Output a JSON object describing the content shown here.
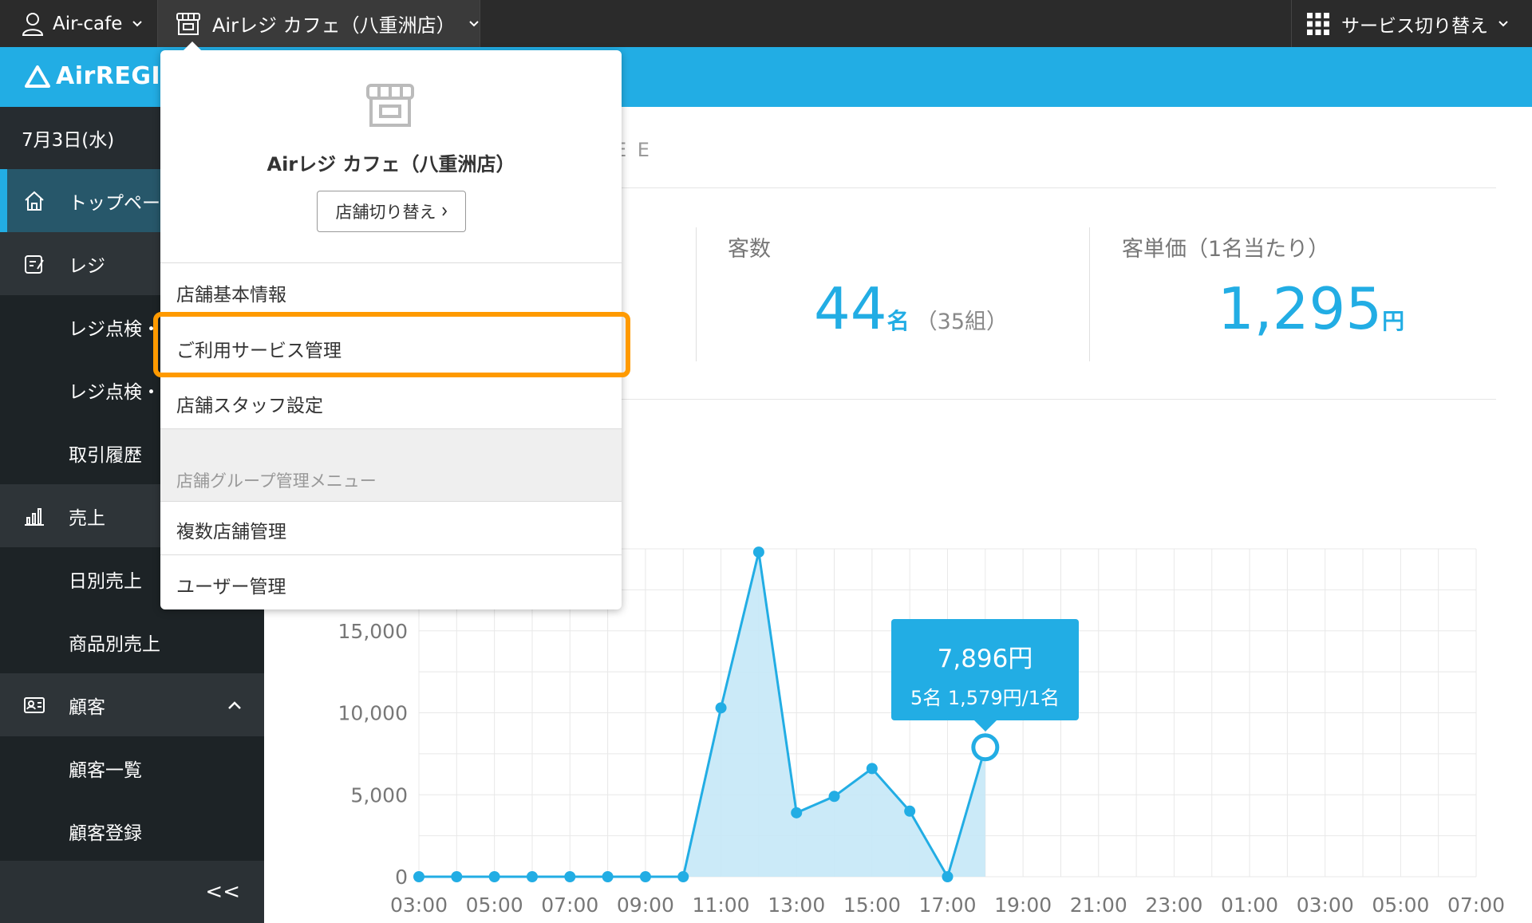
{
  "topbar": {
    "account_name": "Air-cafe",
    "store_name": "Airレジ カフェ（八重洲店）",
    "service_switch": "サービス切り替え"
  },
  "logo": {
    "text": "AirREGI"
  },
  "sidebar": {
    "date": "7月3日(水)",
    "items": [
      {
        "label": "トップページ",
        "icon": "home-icon",
        "type": "main",
        "active": true
      },
      {
        "label": "レジ",
        "icon": "register-icon",
        "type": "main"
      },
      {
        "label": "レジ点検・精算",
        "type": "sub"
      },
      {
        "label": "レジ点検・精算",
        "type": "sub"
      },
      {
        "label": "取引履歴",
        "type": "sub"
      },
      {
        "label": "売上",
        "icon": "sales-chart-icon",
        "type": "main"
      },
      {
        "label": "日別売上",
        "type": "sub"
      },
      {
        "label": "商品別売上",
        "type": "sub"
      },
      {
        "label": "顧客",
        "icon": "customer-card-icon",
        "type": "main"
      },
      {
        "label": "顧客一覧",
        "type": "sub"
      },
      {
        "label": "顧客登録",
        "type": "sub"
      }
    ],
    "collapse_label": "<<"
  },
  "main": {
    "faded_title": "E E",
    "stats": {
      "customers_label": "客数",
      "customers_value": "44",
      "customers_unit": "名",
      "customers_groups": "（35組）",
      "unit_price_label": "客単価（1名当たり）",
      "unit_price_value": "1,295",
      "unit_price_unit": "円"
    }
  },
  "chart_data": {
    "type": "area",
    "x": [
      "03:00",
      "04:00",
      "05:00",
      "06:00",
      "07:00",
      "08:00",
      "09:00",
      "10:00",
      "11:00",
      "12:00",
      "13:00",
      "14:00",
      "15:00",
      "16:00",
      "17:00",
      "18:00"
    ],
    "x_ticks": [
      "03:00",
      "05:00",
      "07:00",
      "09:00",
      "11:00",
      "13:00",
      "15:00",
      "17:00",
      "19:00",
      "21:00",
      "23:00",
      "01:00",
      "03:00",
      "05:00",
      "07:00"
    ],
    "values": [
      0,
      0,
      0,
      0,
      0,
      0,
      0,
      0,
      10300,
      19800,
      3900,
      4900,
      6600,
      4000,
      0,
      7896
    ],
    "y_ticks": [
      "0",
      "5,000",
      "10,000",
      "15,000"
    ],
    "ylim": [
      0,
      20000
    ],
    "grid": true,
    "color": "#22ade4",
    "fill_color": "#c5e8f7"
  },
  "tooltip": {
    "amount": "7,896円",
    "detail": "5名 1,579円/1名"
  },
  "dropdown": {
    "store_name": "Airレジ カフェ（八重洲店）",
    "switch_button": "店舗切り替え",
    "items": [
      "店舗基本情報",
      "ご利用サービス管理",
      "店舗スタッフ設定"
    ],
    "group_label": "店舗グループ管理メニュー",
    "group_items": [
      "複数店舗管理",
      "ユーザー管理"
    ],
    "highlight_color": "#ff9a00"
  }
}
